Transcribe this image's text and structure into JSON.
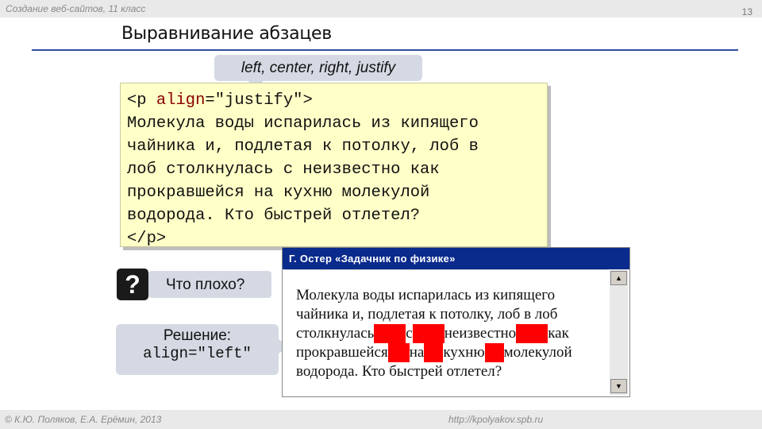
{
  "header": {
    "course": "Создание веб-сайтов, 11 класс",
    "page_number": "13"
  },
  "slide": {
    "title": "Выравнивание абзацев",
    "callout_top": "left, center, right, justify"
  },
  "code_example": {
    "open_tag_start": "<p ",
    "attr": "align",
    "attr_value": "=\"justify\">",
    "lines": [
      "Молекула воды испарилась из кипящего",
      "чайника и, подлетая к потолку, лоб в",
      "лоб столкнулась с неизвестно как",
      "прокравшейся на кухню молекулой",
      "водорода. Кто быстрей отлетел?"
    ],
    "close_tag": "</p>"
  },
  "question": {
    "mark": "?",
    "label": "Что плохо?"
  },
  "solution": {
    "label": "Решение:",
    "code": "align=\"left\""
  },
  "browser_window": {
    "title": "Г. Остер «Задачник по физике»",
    "lines": [
      "Молекула воды испарилась из кипящего",
      "чайника и, подлетая к потолку, лоб в лоб"
    ],
    "line3": [
      "столкнулась",
      "с",
      "неизвестно",
      "как"
    ],
    "line4": [
      "прокравшейся",
      "на",
      "кухню",
      "молекулой"
    ],
    "line5": "водорода. Кто быстрей отлетел?",
    "highlight_color": "#ff0000",
    "scroll_up_icon": "triangle-up",
    "scroll_down_icon": "triangle-down"
  },
  "footer": {
    "authors": "© К.Ю. Поляков, Е.А. Ерёмин, 2013",
    "url": "http://kpolyakov.spb.ru"
  },
  "colors": {
    "title_rule": "#2f4f9f",
    "code_bg": "#ffffc8",
    "callout_bg": "#d4d9e3",
    "window_title_bg": "#0a2a8c"
  }
}
